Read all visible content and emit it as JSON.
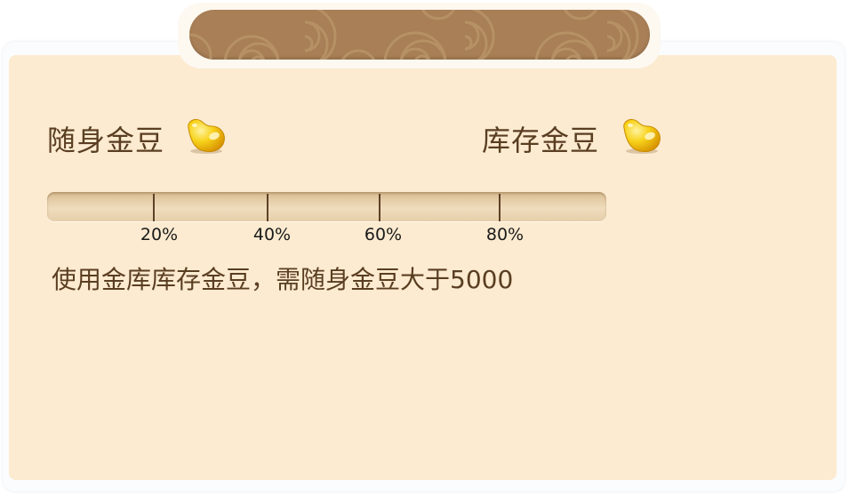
{
  "dialog": {
    "title_tab_color": "#a87f56",
    "panel_color": "#fcebd0"
  },
  "carried_beans": {
    "label": "随身金豆",
    "icon": "gold-bean-icon"
  },
  "stored_beans": {
    "label": "库存金豆",
    "icon": "gold-bean-icon"
  },
  "progress": {
    "value": 0,
    "ticks": [
      "20%",
      "40%",
      "60%",
      "80%"
    ]
  },
  "hint": {
    "text": "使用金库库存金豆，需随身金豆大于5000"
  }
}
